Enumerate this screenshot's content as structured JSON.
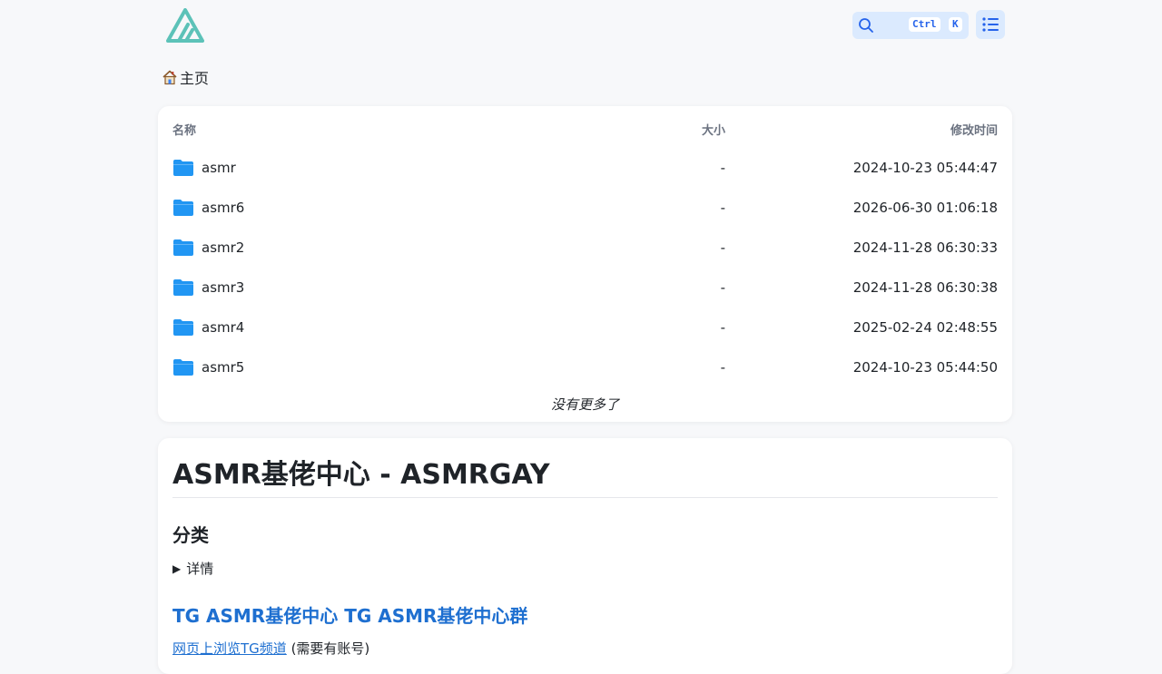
{
  "header": {
    "search_shortcut": [
      "Ctrl",
      "K"
    ]
  },
  "breadcrumb": {
    "home_label": "主页"
  },
  "file_list": {
    "columns": [
      "名称",
      "大小",
      "修改时间"
    ],
    "rows": [
      {
        "name": "asmr",
        "size": "-",
        "modified": "2024-10-23 05:44:47"
      },
      {
        "name": "asmr6",
        "size": "-",
        "modified": "2026-06-30 01:06:18"
      },
      {
        "name": "asmr2",
        "size": "-",
        "modified": "2024-11-28 06:30:33"
      },
      {
        "name": "asmr3",
        "size": "-",
        "modified": "2024-11-28 06:30:38"
      },
      {
        "name": "asmr4",
        "size": "-",
        "modified": "2025-02-24 02:48:55"
      },
      {
        "name": "asmr5",
        "size": "-",
        "modified": "2024-10-23 05:44:50"
      }
    ],
    "no_more": "没有更多了"
  },
  "readme": {
    "title": "ASMR基佬中心 - ASMRGAY",
    "section_heading": "分类",
    "details_summary": "详情",
    "tg_channel_link": "TG ASMR基佬中心",
    "tg_group_link": "TG ASMR基佬中心群",
    "web_view_link": "网页上浏览TG频道",
    "web_view_note": "(需要有账号)"
  },
  "colors": {
    "accent": "#1e6fd0",
    "folder": "#2196f3",
    "logo": "#5cc2b8"
  }
}
